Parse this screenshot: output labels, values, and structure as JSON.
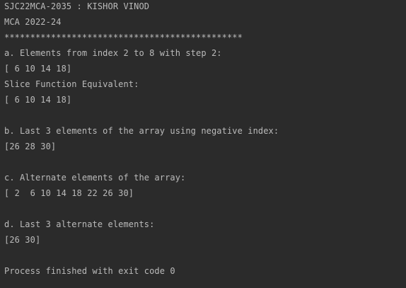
{
  "console": {
    "lines": [
      "SJC22MCA-2035 : KISHOR VINOD",
      "MCA 2022-24",
      "**********************************************",
      "a. Elements from index 2 to 8 with step 2:",
      "[ 6 10 14 18]",
      "Slice Function Equivalent:",
      "[ 6 10 14 18]",
      "",
      "b. Last 3 elements of the array using negative index:",
      "[26 28 30]",
      "",
      "c. Alternate elements of the array:",
      "[ 2  6 10 14 18 22 26 30]",
      "",
      "d. Last 3 alternate elements:",
      "[26 30]",
      "",
      "Process finished with exit code 0"
    ]
  }
}
